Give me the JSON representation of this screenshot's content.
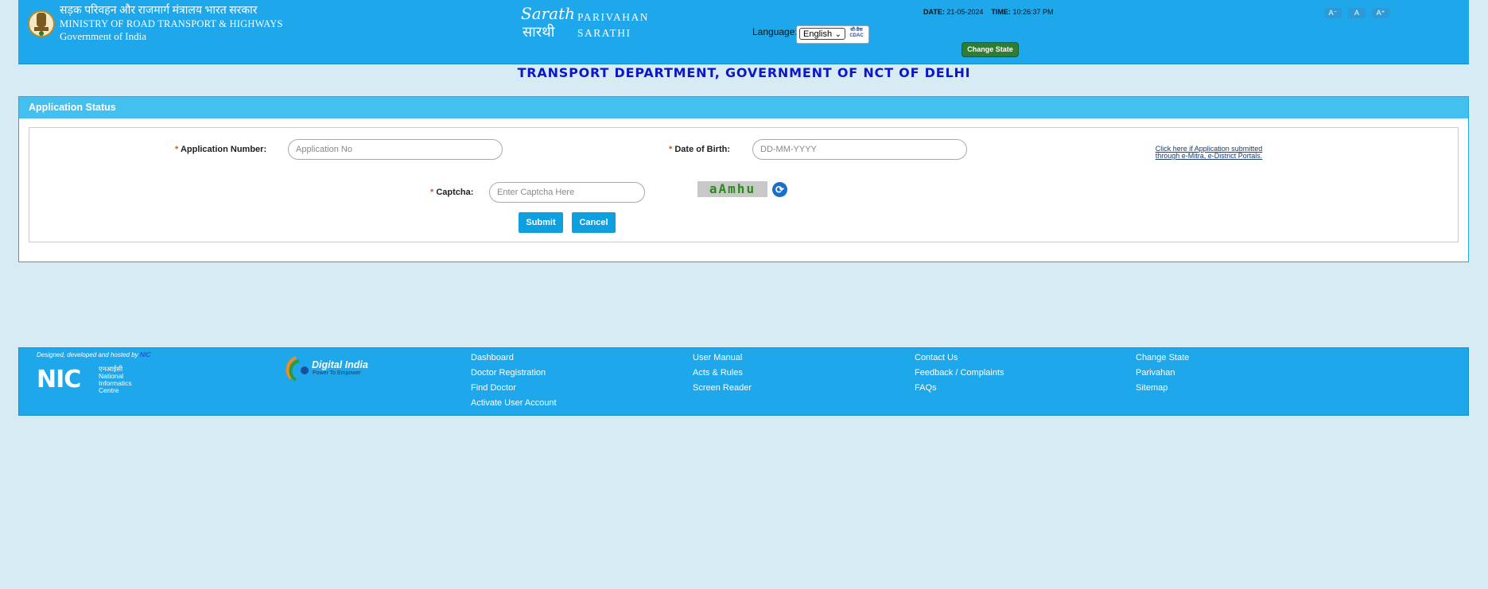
{
  "header": {
    "ministry_hindi": "सड़क परिवहन और राजमार्ग मंत्रालय भारत सरकार",
    "ministry_english": "MINISTRY OF ROAD TRANSPORT & HIGHWAYS",
    "government": "Government of India",
    "sarathi_line1": "PARIVAHAN",
    "sarathi_line2": "SARATHI",
    "language_label": "Language:",
    "language_value": "English",
    "cdac_label": "सी-डैक CDAC",
    "date_label": "DATE:",
    "date_value": "21-05-2024",
    "time_label": "TIME:",
    "time_value": "10:26:37 PM",
    "change_state_label": "Change State",
    "font_decrease": "A⁻",
    "font_normal": "A",
    "font_increase": "A⁺"
  },
  "department_title": "TRANSPORT DEPARTMENT, GOVERNMENT OF NCT OF DELHI",
  "panel": {
    "title": "Application Status",
    "required_mark": "*",
    "application_number_label": "Application Number:",
    "application_number_placeholder": "Application No",
    "dob_label": "Date of Birth:",
    "dob_placeholder": "DD-MM-YYYY",
    "emitra_link_line1": "Click here if Application submitted",
    "emitra_link_line2": "through e-Mitra, e-District Portals.",
    "captcha_label": "Captcha:",
    "captcha_placeholder": "Enter Captcha Here",
    "captcha_text": "aAmhu",
    "refresh_glyph": "⟳",
    "submit_label": "Submit",
    "cancel_label": "Cancel"
  },
  "footer": {
    "designed_by": "Designed, developed and hosted by",
    "designed_by_org": "NIC",
    "nic_big": "NIC",
    "nic_hindi": "एनआईसी",
    "nic_line1": "National",
    "nic_line2": "Informatics",
    "nic_line3": "Centre",
    "digital_india": "Digital India",
    "digital_india_tagline": "Power To Empower",
    "col1": [
      "Dashboard",
      "Doctor Registration",
      "Find Doctor",
      "Activate User Account"
    ],
    "col2": [
      "User Manual",
      "Acts & Rules",
      "Screen Reader"
    ],
    "col3": [
      "Contact Us",
      "Feedback / Complaints",
      "FAQs"
    ],
    "col4": [
      "Change State",
      "Parivahan",
      "Sitemap"
    ]
  },
  "colors": {
    "header_bg": "#1ea7ea",
    "page_bg": "#d7ebf5",
    "title_color": "#0b18c8",
    "button_bg": "#0d9fe0",
    "change_state_bg": "#2e7d32"
  }
}
